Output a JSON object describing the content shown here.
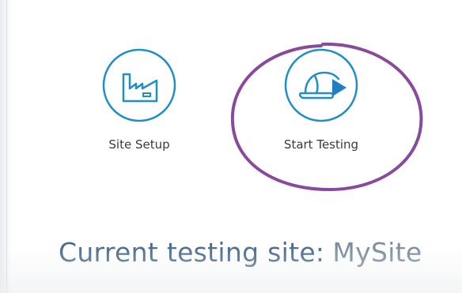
{
  "tiles": [
    {
      "id": "site-setup",
      "label": "Site Setup",
      "icon": "factory-icon"
    },
    {
      "id": "start-testing",
      "label": "Start Testing",
      "icon": "hardhat-play-icon"
    }
  ],
  "status": {
    "current_site_label": "Current testing site:",
    "current_site_value": "MySite"
  },
  "colors": {
    "icon_stroke": "#1f8fc5",
    "annotation": "#8a4a9c",
    "status_text": "#4a6b8f"
  }
}
